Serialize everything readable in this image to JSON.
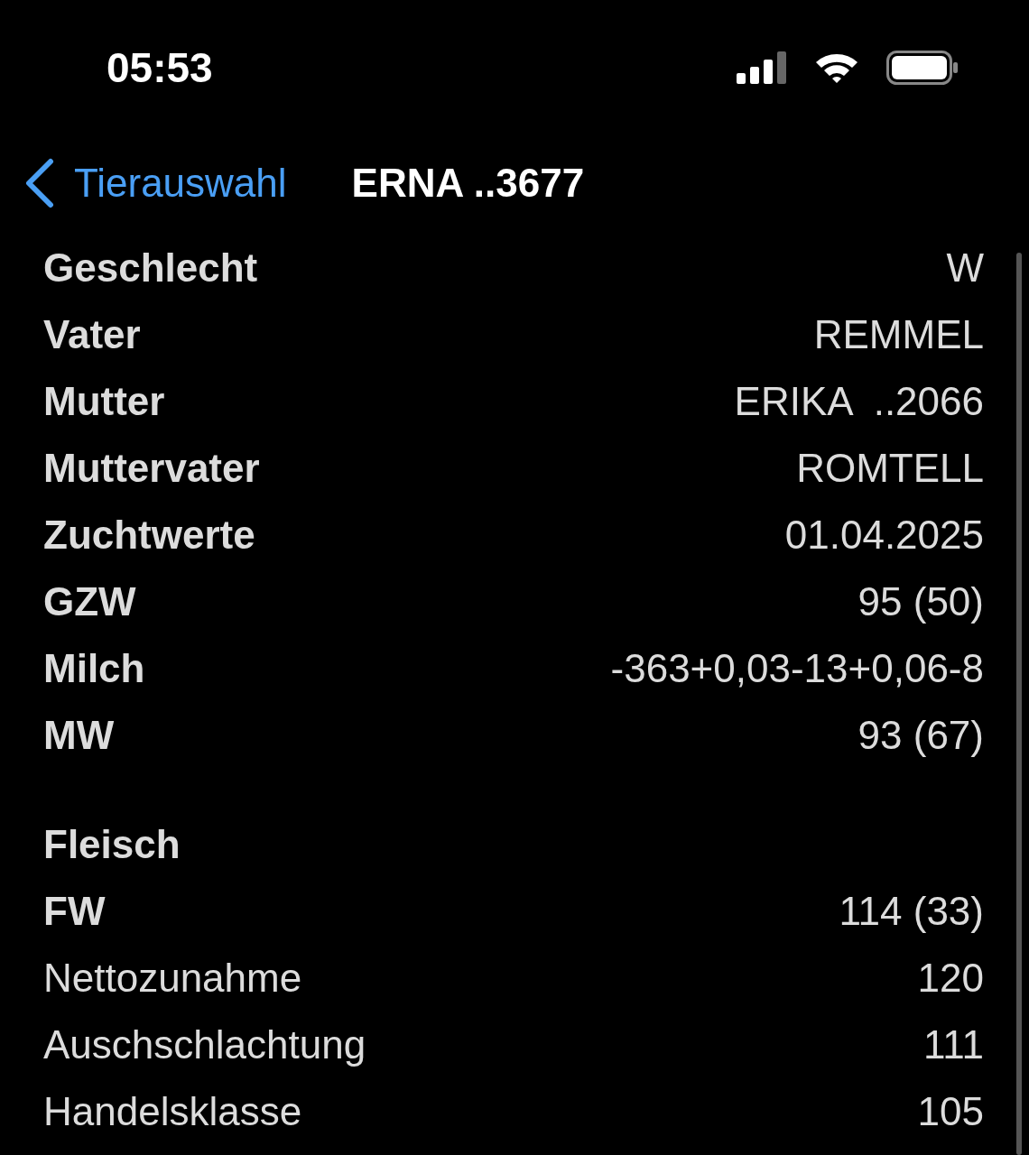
{
  "status_bar": {
    "time": "05:53"
  },
  "nav": {
    "back": "Tierauswahl",
    "title": "ERNA ..3677"
  },
  "sections": [
    {
      "rows": [
        {
          "kind": "key",
          "label": "Geschlecht",
          "value": "W"
        },
        {
          "kind": "key",
          "label": "Vater",
          "value": "REMMEL"
        },
        {
          "kind": "key",
          "label": "Mutter",
          "value": "ERIKA  ..2066"
        },
        {
          "kind": "key",
          "label": "Muttervater",
          "value": "ROMTELL"
        },
        {
          "kind": "key",
          "label": "Zuchtwerte",
          "value": "01.04.2025"
        },
        {
          "kind": "key",
          "label": "GZW",
          "value": "95 (50)"
        },
        {
          "kind": "key",
          "label": "Milch",
          "value": "-363+0,03-13+0,06-8"
        },
        {
          "kind": "key",
          "label": "MW",
          "value": "93 (67)"
        }
      ]
    },
    {
      "rows": [
        {
          "kind": "heading",
          "label": "Fleisch"
        },
        {
          "kind": "key",
          "label": "FW",
          "value": "114 (33)"
        },
        {
          "kind": "detail",
          "label": "Nettozunahme",
          "value": "120"
        },
        {
          "kind": "detail",
          "label": "Auschschlachtung",
          "value": "111"
        },
        {
          "kind": "detail",
          "label": "Handelsklasse",
          "value": "105"
        }
      ]
    }
  ]
}
